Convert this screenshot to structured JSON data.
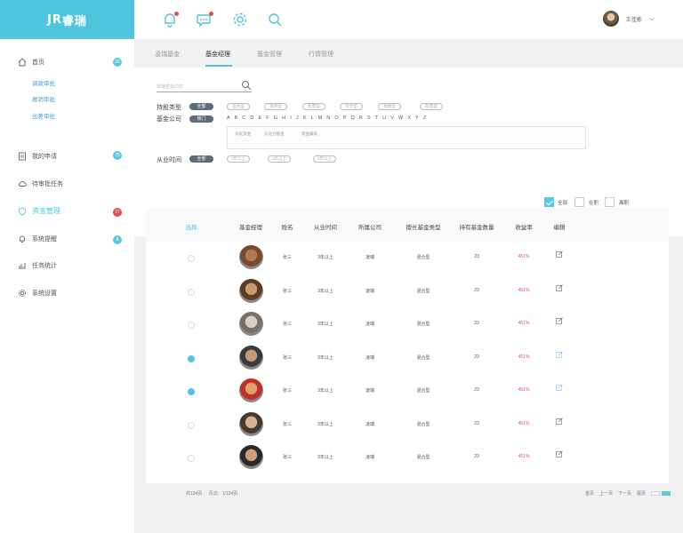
{
  "brand": {
    "logo_mark": "JR",
    "name": "睿瑞"
  },
  "header": {
    "user_name": "王佳栋",
    "caret": "⌵"
  },
  "sidebar": {
    "home": {
      "label": "首页",
      "badge": "20"
    },
    "sub_items": [
      "调款审批",
      "报销审批",
      "出差审批"
    ],
    "items": [
      {
        "label": "我的申请",
        "badge": "79"
      },
      {
        "label": "待审批任务",
        "badge": ""
      },
      {
        "label": "资金管理",
        "badge": "27"
      },
      {
        "label": "系统提醒",
        "badge": "8"
      },
      {
        "label": "任务统计",
        "badge": ""
      },
      {
        "label": "系统设置",
        "badge": ""
      }
    ]
  },
  "tabs": [
    "凌瑞基金",
    "基金经理",
    "基金管理",
    "行情管理"
  ],
  "filter": {
    "search_placeholder": "快速查找内容",
    "type_label": "持股类型",
    "all_label": "全部",
    "types": [
      "混合型",
      "债券型",
      "股票型",
      "货币型",
      "指数型",
      "股票型"
    ],
    "company_label": "基金公司",
    "hot_label": "热门",
    "letters": "A B C D E F G H I J K L M N O P Q R S T U V W X Y Z",
    "companies": [
      "天虹资金",
      "从证力基金",
      "资金编号"
    ],
    "time_label": "从业时间",
    "time_all": "全部",
    "times": [
      "1年以上",
      "3年以上",
      "5年以上"
    ],
    "status": [
      {
        "label": "全部",
        "checked": true
      },
      {
        "label": "在职",
        "checked": false
      },
      {
        "label": "离职",
        "checked": false
      }
    ]
  },
  "table": {
    "headers": [
      "选择",
      "基金经理",
      "姓名",
      "从业时间",
      "所属公司",
      "擅长基金类型",
      "持有基金数量",
      "收益率",
      "编辑"
    ],
    "rows": [
      {
        "selected": false,
        "name": "张三",
        "years": "3年以上",
        "company": "凌瑞",
        "type": "混合型",
        "count": "23",
        "rate": "451%"
      },
      {
        "selected": false,
        "name": "张三",
        "years": "3年以上",
        "company": "凌瑞",
        "type": "混合型",
        "count": "23",
        "rate": "451%"
      },
      {
        "selected": false,
        "name": "张三",
        "years": "3年以上",
        "company": "凌瑞",
        "type": "混合型",
        "count": "23",
        "rate": "451%"
      },
      {
        "selected": true,
        "name": "张三",
        "years": "3年以上",
        "company": "凌瑞",
        "type": "混合型",
        "count": "23",
        "rate": "451%"
      },
      {
        "selected": true,
        "name": "张三",
        "years": "3年以上",
        "company": "凌瑞",
        "type": "混合型",
        "count": "23",
        "rate": "451%"
      },
      {
        "selected": false,
        "name": "张三",
        "years": "3年以上",
        "company": "凌瑞",
        "type": "混合型",
        "count": "23",
        "rate": "451%"
      },
      {
        "selected": false,
        "name": "张三",
        "years": "3年以上",
        "company": "凌瑞",
        "type": "混合型",
        "count": "23",
        "rate": "451%"
      }
    ]
  },
  "footer": {
    "total": "共124页",
    "page": "页次：1/124页"
  },
  "pager": {
    "first": "首页",
    "prev": "上一页",
    "next": "下一页",
    "last": "尾页"
  }
}
